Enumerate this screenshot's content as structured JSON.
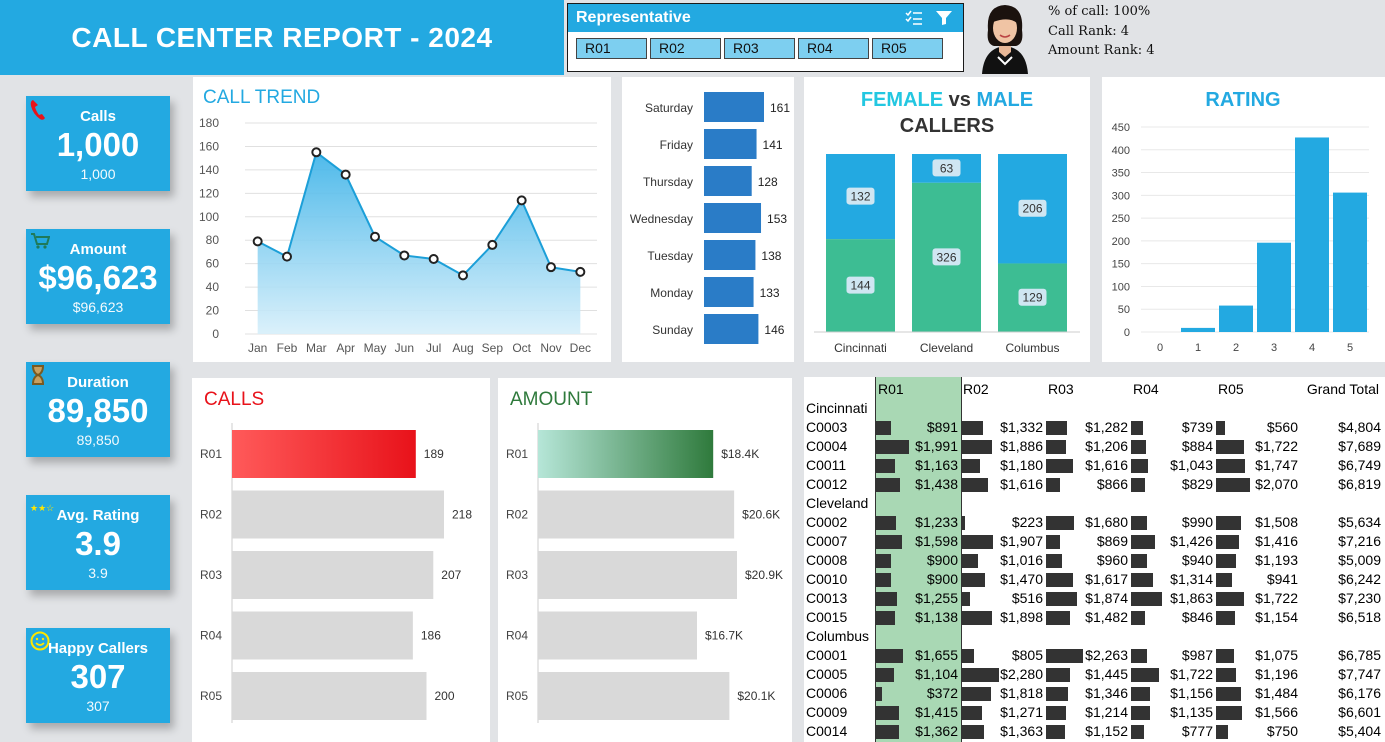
{
  "header": {
    "title": "CALL CENTER REPORT - 2024"
  },
  "slicer": {
    "title": "Representative",
    "multi_select_icon": "multi-select-icon",
    "filter_icon": "filter-icon",
    "items": [
      "R01",
      "R02",
      "R03",
      "R04",
      "R05"
    ]
  },
  "profile": {
    "line1": "% of call: 100%",
    "line2": "Call Rank: 4",
    "line3": "Amount Rank: 4"
  },
  "kpis": [
    {
      "label": "Calls",
      "value": "1,000",
      "sub": "1,000",
      "icon": "phone-icon"
    },
    {
      "label": "Amount",
      "value": "$96,623",
      "sub": "$96,623",
      "icon": "cart-icon"
    },
    {
      "label": "Duration",
      "value": "89,850",
      "sub": "89,850",
      "icon": "hourglass-icon"
    },
    {
      "label": "Avg. Rating",
      "value": "3.9",
      "sub": "3.9",
      "icon": "stars-icon"
    },
    {
      "label": "Happy Callers",
      "value": "307",
      "sub": "307",
      "icon": "smiley-icon"
    }
  ],
  "colors": {
    "accent": "#23a9e1",
    "female": "#23a9e1",
    "male": "#3dbd93",
    "day_bar": "#2a7cc7",
    "calls_highlight": "#e8121a",
    "amount_highlight": "#2f7a3c",
    "gray_bar": "#d9d9d9",
    "pivot_highlight": "#a9d8b4"
  },
  "chart_data": [
    {
      "id": "call_trend",
      "type": "area",
      "title": "CALL TREND",
      "categories": [
        "Jan",
        "Feb",
        "Mar",
        "Apr",
        "May",
        "Jun",
        "Jul",
        "Aug",
        "Sep",
        "Oct",
        "Nov",
        "Dec"
      ],
      "values": [
        79,
        66,
        155,
        136,
        83,
        67,
        64,
        50,
        76,
        114,
        57,
        53
      ],
      "ylim": [
        0,
        180
      ],
      "yticks": [
        0,
        20,
        40,
        60,
        80,
        100,
        120,
        140,
        160,
        180
      ],
      "grid": true
    },
    {
      "id": "weekday",
      "type": "bar",
      "categories": [
        "Saturday",
        "Friday",
        "Thursday",
        "Wednesday",
        "Tuesday",
        "Monday",
        "Sunday"
      ],
      "values": [
        161,
        141,
        128,
        153,
        138,
        133,
        146
      ]
    },
    {
      "id": "gender",
      "type": "bar",
      "stacked": true,
      "title_part1": "FEMALE",
      "title_part2": "vs",
      "title_part3": "MALE",
      "title_line2": "CALLERS",
      "categories": [
        "Cincinnati",
        "Cleveland",
        "Columbus"
      ],
      "series": [
        {
          "values": [
            132,
            63,
            206
          ]
        },
        {
          "values": [
            144,
            326,
            129
          ]
        }
      ]
    },
    {
      "id": "rating",
      "type": "bar",
      "title": "RATING",
      "categories": [
        "0",
        "1",
        "2",
        "3",
        "4",
        "5"
      ],
      "values": [
        0,
        9,
        58,
        196,
        427,
        306
      ],
      "ylim": [
        0,
        450
      ],
      "yticks": [
        0,
        50,
        100,
        150,
        200,
        250,
        300,
        350,
        400,
        450
      ]
    },
    {
      "id": "calls_by_rep",
      "type": "bar",
      "title": "CALLS",
      "categories": [
        "R01",
        "R02",
        "R03",
        "R04",
        "R05"
      ],
      "values": [
        189,
        218,
        207,
        186,
        200
      ],
      "labels": [
        "189",
        "218",
        "207",
        "186",
        "200"
      ]
    },
    {
      "id": "amount_by_rep",
      "type": "bar",
      "title": "AMOUNT",
      "categories": [
        "R01",
        "R02",
        "R03",
        "R04",
        "R05"
      ],
      "values": [
        18400,
        20600,
        20900,
        16700,
        20100
      ],
      "labels": [
        "$18.4K",
        "$20.6K",
        "$20.9K",
        "$16.7K",
        "$20.1K"
      ]
    },
    {
      "id": "pivot",
      "type": "table",
      "columns": [
        "R01",
        "R02",
        "R03",
        "R04",
        "R05",
        "Grand Total"
      ],
      "rows": [
        {
          "group": "Cincinnati"
        },
        {
          "label": "C0003",
          "values": [
            "$891",
            "$1,332",
            "$1,282",
            "$739",
            "$560",
            "$4,804"
          ],
          "nums": [
            891,
            1332,
            1282,
            739,
            560
          ]
        },
        {
          "label": "C0004",
          "values": [
            "$1,991",
            "$1,886",
            "$1,206",
            "$884",
            "$1,722",
            "$7,689"
          ],
          "nums": [
            1991,
            1886,
            1206,
            884,
            1722
          ]
        },
        {
          "label": "C0011",
          "values": [
            "$1,163",
            "$1,180",
            "$1,616",
            "$1,043",
            "$1,747",
            "$6,749"
          ],
          "nums": [
            1163,
            1180,
            1616,
            1043,
            1747
          ]
        },
        {
          "label": "C0012",
          "values": [
            "$1,438",
            "$1,616",
            "$866",
            "$829",
            "$2,070",
            "$6,819"
          ],
          "nums": [
            1438,
            1616,
            866,
            829,
            2070
          ]
        },
        {
          "group": "Cleveland"
        },
        {
          "label": "C0002",
          "values": [
            "$1,233",
            "$223",
            "$1,680",
            "$990",
            "$1,508",
            "$5,634"
          ],
          "nums": [
            1233,
            223,
            1680,
            990,
            1508
          ]
        },
        {
          "label": "C0007",
          "values": [
            "$1,598",
            "$1,907",
            "$869",
            "$1,426",
            "$1,416",
            "$7,216"
          ],
          "nums": [
            1598,
            1907,
            869,
            1426,
            1416
          ]
        },
        {
          "label": "C0008",
          "values": [
            "$900",
            "$1,016",
            "$960",
            "$940",
            "$1,193",
            "$5,009"
          ],
          "nums": [
            900,
            1016,
            960,
            940,
            1193
          ]
        },
        {
          "label": "C0010",
          "values": [
            "$900",
            "$1,470",
            "$1,617",
            "$1,314",
            "$941",
            "$6,242"
          ],
          "nums": [
            900,
            1470,
            1617,
            1314,
            941
          ]
        },
        {
          "label": "C0013",
          "values": [
            "$1,255",
            "$516",
            "$1,874",
            "$1,863",
            "$1,722",
            "$7,230"
          ],
          "nums": [
            1255,
            516,
            1874,
            1863,
            1722
          ]
        },
        {
          "label": "C0015",
          "values": [
            "$1,138",
            "$1,898",
            "$1,482",
            "$846",
            "$1,154",
            "$6,518"
          ],
          "nums": [
            1138,
            1898,
            1482,
            846,
            1154
          ]
        },
        {
          "group": "Columbus"
        },
        {
          "label": "C0001",
          "values": [
            "$1,655",
            "$805",
            "$2,263",
            "$987",
            "$1,075",
            "$6,785"
          ],
          "nums": [
            1655,
            805,
            2263,
            987,
            1075
          ]
        },
        {
          "label": "C0005",
          "values": [
            "$1,104",
            "$2,280",
            "$1,445",
            "$1,722",
            "$1,196",
            "$7,747"
          ],
          "nums": [
            1104,
            2280,
            1445,
            1722,
            1196
          ]
        },
        {
          "label": "C0006",
          "values": [
            "$372",
            "$1,818",
            "$1,346",
            "$1,156",
            "$1,484",
            "$6,176"
          ],
          "nums": [
            372,
            1818,
            1346,
            1156,
            1484
          ]
        },
        {
          "label": "C0009",
          "values": [
            "$1,415",
            "$1,271",
            "$1,214",
            "$1,135",
            "$1,566",
            "$6,601"
          ],
          "nums": [
            1415,
            1271,
            1214,
            1135,
            1566
          ]
        },
        {
          "label": "C0014",
          "values": [
            "$1,362",
            "$1,363",
            "$1,152",
            "$777",
            "$750",
            "$5,404"
          ],
          "nums": [
            1362,
            1363,
            1152,
            777,
            750
          ]
        }
      ]
    }
  ]
}
